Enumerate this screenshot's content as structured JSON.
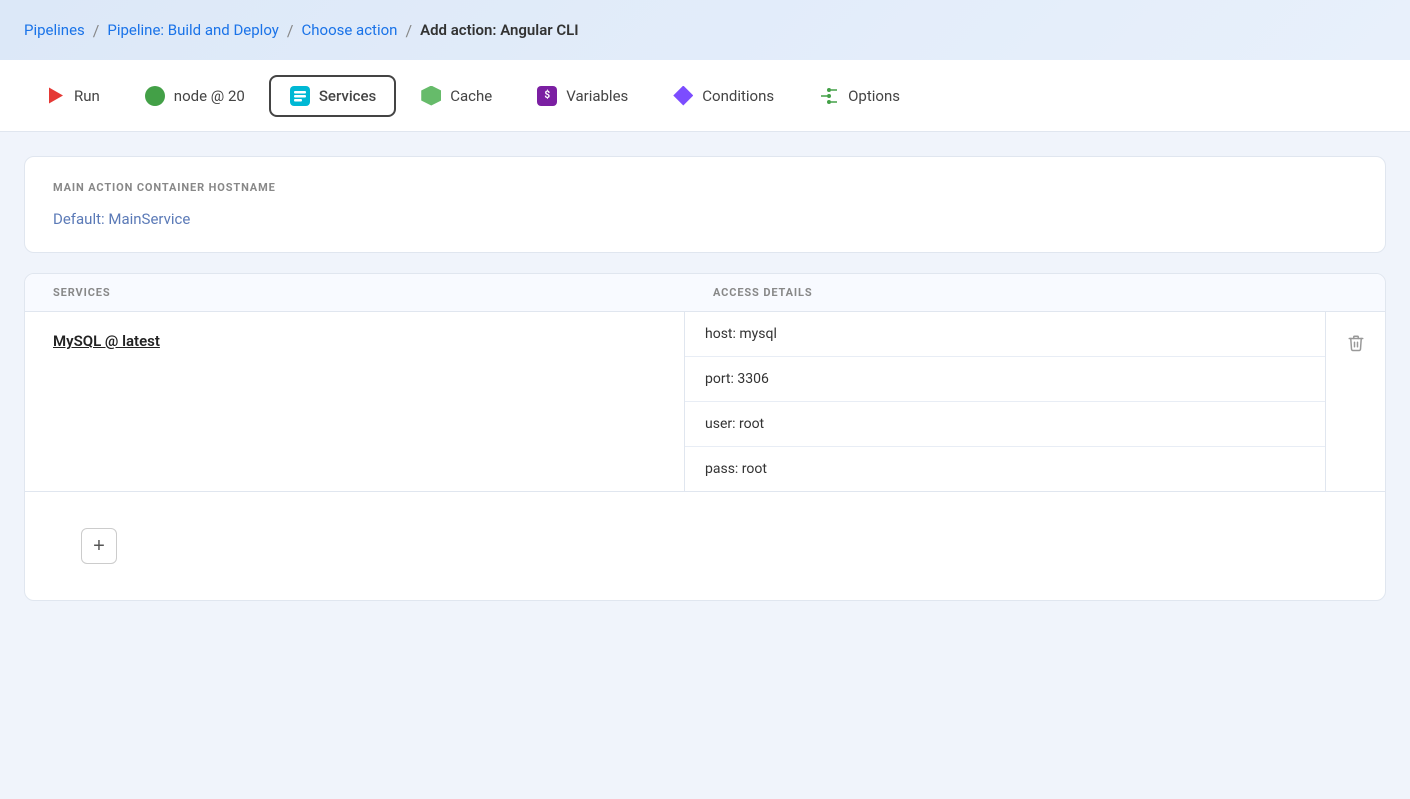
{
  "breadcrumb": {
    "items": [
      {
        "label": "Pipelines",
        "link": true
      },
      {
        "label": "Pipeline: Build and Deploy",
        "link": true
      },
      {
        "label": "Choose action",
        "link": true
      },
      {
        "label": "Add action: Angular CLI",
        "link": false
      }
    ],
    "separator": "/"
  },
  "tabs": [
    {
      "id": "run",
      "label": "Run",
      "icon": "run-icon",
      "active": false
    },
    {
      "id": "node",
      "label": "node @ 20",
      "icon": "node-icon",
      "active": false
    },
    {
      "id": "services",
      "label": "Services",
      "icon": "services-icon",
      "active": true
    },
    {
      "id": "cache",
      "label": "Cache",
      "icon": "cache-icon",
      "active": false
    },
    {
      "id": "variables",
      "label": "Variables",
      "icon": "variables-icon",
      "active": false
    },
    {
      "id": "conditions",
      "label": "Conditions",
      "icon": "conditions-icon",
      "active": false
    },
    {
      "id": "options",
      "label": "Options",
      "icon": "options-icon",
      "active": false
    }
  ],
  "hostname_section": {
    "label": "MAIN ACTION CONTAINER HOSTNAME",
    "default_text": "Default: MainService"
  },
  "services_section": {
    "services_column_label": "SERVICES",
    "access_column_label": "ACCESS DETAILS",
    "rows": [
      {
        "name": "MySQL @ latest",
        "access_details": [
          "host: mysql",
          "port: 3306",
          "user: root",
          "pass: root"
        ]
      }
    ],
    "add_button_label": "+"
  }
}
